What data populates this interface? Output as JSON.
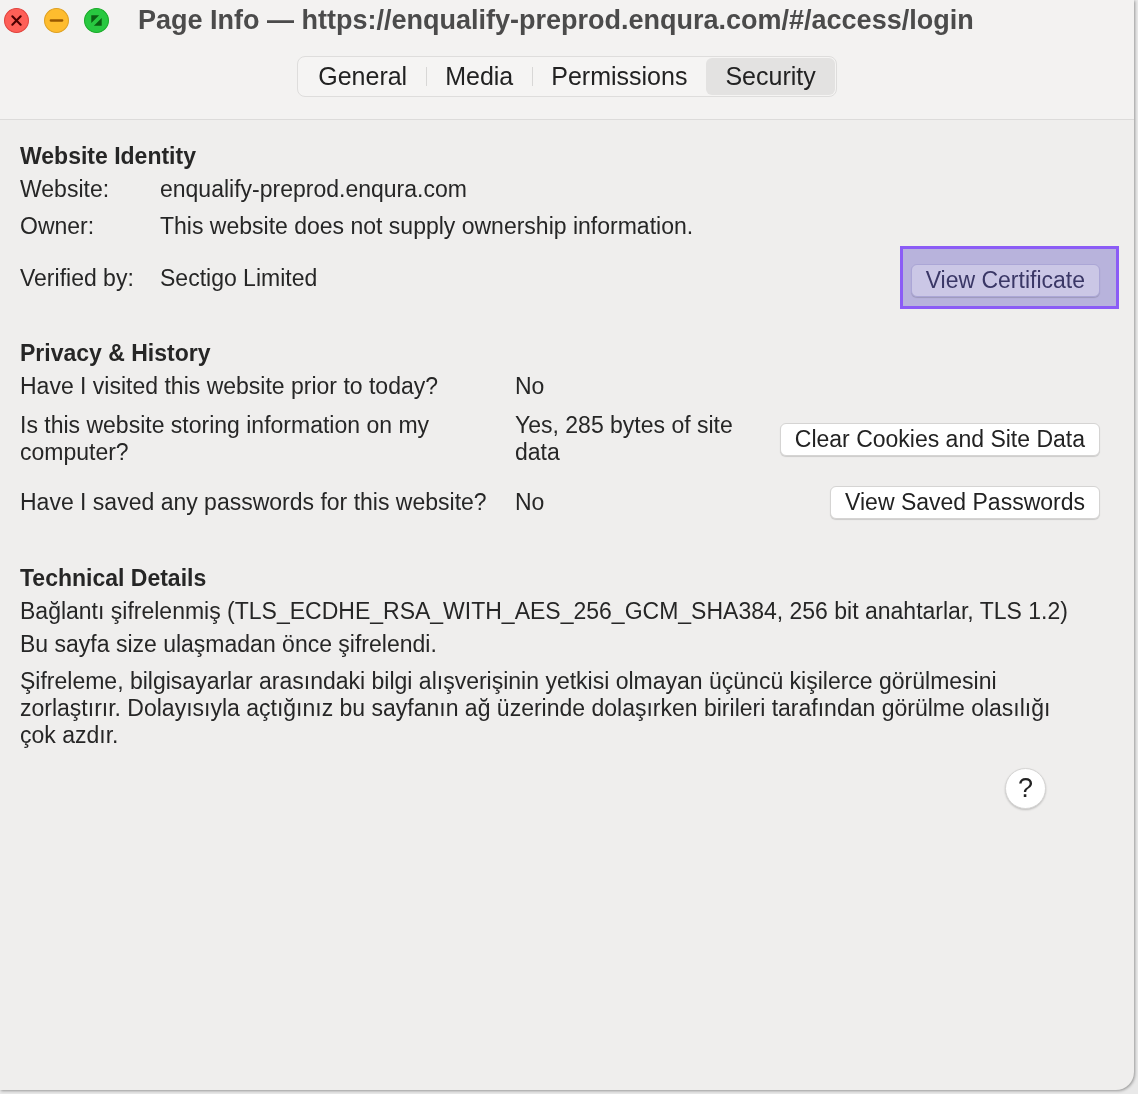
{
  "window": {
    "title": "Page Info — https://enqualify-preprod.enqura.com/#/access/login"
  },
  "tabs": [
    {
      "label": "General",
      "selected": false
    },
    {
      "label": "Media",
      "selected": false
    },
    {
      "label": "Permissions",
      "selected": false
    },
    {
      "label": "Security",
      "selected": true
    }
  ],
  "website_identity": {
    "heading": "Website Identity",
    "fields": [
      {
        "label": "Website:",
        "value": "enqualify-preprod.enqura.com"
      },
      {
        "label": "Owner:",
        "value": "This website does not supply ownership information."
      },
      {
        "label": "Verified by:",
        "value": "Sectigo Limited",
        "button": {
          "label": "View Certificate",
          "focused": true
        }
      }
    ]
  },
  "privacy_history": {
    "heading": "Privacy & History",
    "rows": [
      {
        "question": "Have I visited this website prior to today?",
        "answer": "No"
      },
      {
        "question": "Is this website storing information on my computer?",
        "answer": "Yes, 285 bytes of site data",
        "button": {
          "label": "Clear Cookies and Site Data",
          "focused": false
        }
      },
      {
        "question": "Have I saved any passwords for this website?",
        "answer": "No",
        "button": {
          "label": "View Saved Passwords",
          "focused": false
        }
      }
    ]
  },
  "technical_details": {
    "heading": "Technical Details",
    "paragraphs": [
      "Bağlantı şifrelenmiş (TLS_ECDHE_RSA_WITH_AES_256_GCM_SHA384, 256 bit anahtarlar, TLS 1.2)",
      "Bu sayfa size ulaşmadan önce şifrelendi.",
      "Şifreleme, bilgisayarlar arasındaki bilgi alışverişinin yetkisi olmayan üçüncü kişilerce görülmesini zorlaştırır. Dolayısıyla açtığınız bu sayfanın ağ üzerinde dolaşırken birileri tarafından görülme olasılığı çok azdır."
    ]
  },
  "help_button": {
    "label": "?"
  }
}
